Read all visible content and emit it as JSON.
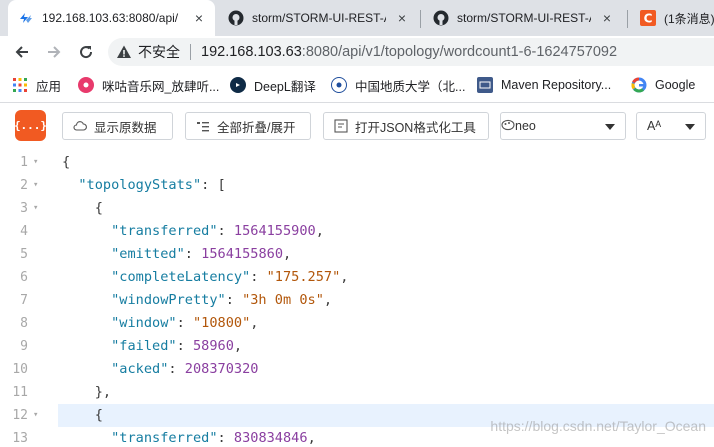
{
  "browser": {
    "tabs": [
      {
        "title": "192.168.103.63:8080/api/",
        "active": true
      },
      {
        "title": "storm/STORM-UI-REST-A",
        "active": false
      },
      {
        "title": "storm/STORM-UI-REST-A",
        "active": false
      },
      {
        "title": "(1条消息)",
        "active": false
      }
    ],
    "close_glyph": "×",
    "address": {
      "insecure_label": "不安全",
      "host": "192.168.103.63",
      "path": ":8080/api/v1/topology/wordcount1-6-1624757092"
    },
    "bookmarks": [
      {
        "label": "应用",
        "icon": "apps-grid-icon"
      },
      {
        "label": "咪咕音乐网_放肆听...",
        "icon": "migu-icon"
      },
      {
        "label": "DeepL翻译",
        "icon": "deepl-icon"
      },
      {
        "label": "中国地质大学（北...",
        "icon": "university-icon"
      },
      {
        "label": "Maven Repository...",
        "icon": "maven-icon"
      },
      {
        "label": "Google",
        "icon": "google-icon"
      }
    ]
  },
  "viewer": {
    "logo_text": "{...}",
    "show_raw_label": "显示原数据",
    "fold_all_label": "全部折叠/展开",
    "open_tool_label": "打开JSON格式化工具",
    "theme_value": "neo",
    "font_value": "Aᴬ"
  },
  "colors": {
    "accent": "#f15a22",
    "key": "#167da1",
    "string": "#b2570b",
    "number": "#8a3fa0",
    "highlight": "#e8f2fe"
  },
  "code_lines": [
    {
      "num": "1",
      "fold": "▾",
      "text": "{",
      "hl": false
    },
    {
      "num": "2",
      "fold": "▾",
      "text": "  \"topologyStats\": [",
      "hl": false
    },
    {
      "num": "3",
      "fold": "▾",
      "text": "    {",
      "hl": false
    },
    {
      "num": "4",
      "fold": "",
      "text": "      \"transferred\": 1564155900,",
      "hl": false
    },
    {
      "num": "5",
      "fold": "",
      "text": "      \"emitted\": 1564155860,",
      "hl": false
    },
    {
      "num": "6",
      "fold": "",
      "text": "      \"completeLatency\": \"175.257\",",
      "hl": false
    },
    {
      "num": "7",
      "fold": "",
      "text": "      \"windowPretty\": \"3h 0m 0s\",",
      "hl": false
    },
    {
      "num": "8",
      "fold": "",
      "text": "      \"window\": \"10800\",",
      "hl": false
    },
    {
      "num": "9",
      "fold": "",
      "text": "      \"failed\": 58960,",
      "hl": false
    },
    {
      "num": "10",
      "fold": "",
      "text": "      \"acked\": 208370320",
      "hl": false
    },
    {
      "num": "11",
      "fold": "",
      "text": "    },",
      "hl": false
    },
    {
      "num": "12",
      "fold": "▾",
      "text": "    {",
      "hl": true
    },
    {
      "num": "13",
      "fold": "",
      "text": "      \"transferred\": 830834846,",
      "hl": false
    }
  ],
  "watermark": "https://blog.csdn.net/Taylor_Ocean"
}
